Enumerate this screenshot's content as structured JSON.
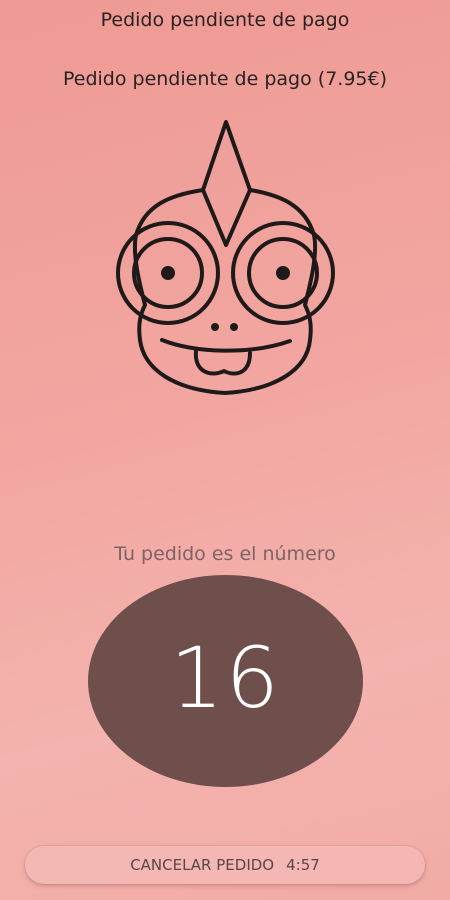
{
  "header": {
    "title": "Pedido pendiente de pago",
    "subtitle": "Pedido pendiente de pago (7.95€)"
  },
  "mascot": {
    "icon": "chameleon-face-icon"
  },
  "order": {
    "label": "Tu pedido es el número",
    "number": "16"
  },
  "cancel": {
    "label": "CANCELAR PEDIDO",
    "countdown": "4:57"
  },
  "colors": {
    "background": "#f2a6a1",
    "oval": "#6f4f4c",
    "text": "#2a2222"
  }
}
